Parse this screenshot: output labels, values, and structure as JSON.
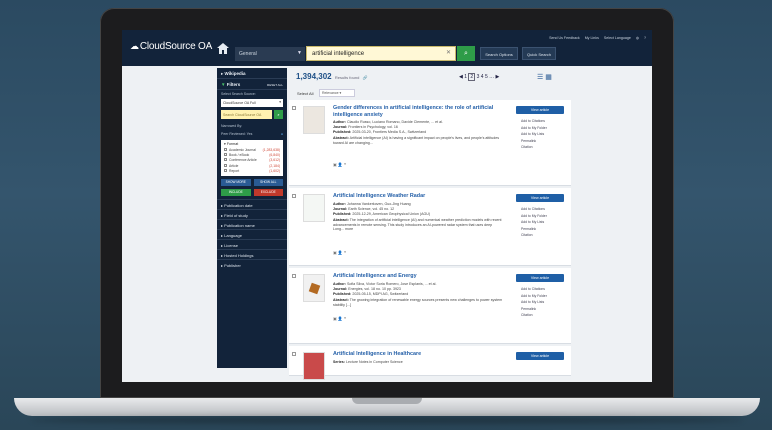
{
  "header": {
    "logo": "CloudSource OA",
    "search_type": "General",
    "search_query": "artificial intelligence",
    "btn_search_options": "Search Options",
    "btn_quick_search": "Quick Search",
    "top_links": [
      "Send Us Feedback",
      "My Links",
      "Select Language"
    ]
  },
  "sidebar": {
    "wikipedia_label": "Wikipedia",
    "filters_label": "Filters",
    "reset_label": "RESET ALL",
    "select_source_label": "Select Search Source:",
    "source_value": "CloudSource OA Full",
    "search_within_placeholder": "Search CloudSource OA",
    "narrowed_by": "Narrowed By:",
    "narrowed_value": "Peer Reviewed: Yes",
    "source_type_label": "Format",
    "source_types": [
      {
        "label": "Academic Journal",
        "count": "(1,283,638)"
      },
      {
        "label": "Book / eBook",
        "count": "(6,840)"
      },
      {
        "label": "Conference Article",
        "count": "(3,612)"
      },
      {
        "label": "Article",
        "count": "(2,184)"
      },
      {
        "label": "Report",
        "count": "(1,602)"
      }
    ],
    "btn_show_more": "SHOW MORE",
    "btn_show_all": "SHOW ALL",
    "btn_include": "INCLUDE",
    "btn_exclude": "EXCLUDE",
    "categories": [
      "Publication date",
      "Field of study",
      "Publication name",
      "Language",
      "License",
      "Hosted Holdings",
      "Publisher"
    ]
  },
  "results": {
    "count": "1,394,302",
    "count_suffix": "Results found",
    "select_all": "Select All",
    "sort": "Relevance",
    "pages": [
      "1",
      "2",
      "3",
      "4",
      "5"
    ]
  },
  "cards": [
    {
      "title": "Gender differences in artificial intelligence: the role of artificial intelligence anxiety",
      "author": "Claudio Russo, Luciano Romano, Davide Clemente, ... et al.",
      "journal": "Frontiers in Psychology, vol. 16",
      "published": "2025-03-20, Frontiers Media S.A., Switzerland",
      "abstract": "Artificial intelligence (AI) is having a significant impact on people's lives, and people's attitudes toward AI are changing...",
      "view_label": "View article",
      "actions": [
        "Add to Citations",
        "Add to My Folder",
        "Add to My Lists",
        "Permalink",
        "Citation"
      ]
    },
    {
      "title": "Artificial Intelligence Weather Radar",
      "author": "Johanna Vankerkoven, Guo-Jing Huang",
      "journal": "Earth Science, vol. 45 no. 12",
      "published": "2025-12-29, American Geophysical Union (AGU)",
      "abstract": "The integration of artificial intelligence (AI) and numerical weather prediction models with recent advancements in remote sensing. This study introduces an AI-powered radar system that uses deep Long... more",
      "view_label": "View article",
      "actions": [
        "Add to Citations",
        "Add to My Folder",
        "Add to My Lists",
        "Permalink",
        "Citation"
      ]
    },
    {
      "title": "Artificial Intelligence and Energy",
      "author": "Sofia Silva, Víctor Soria Romero, Jose Esplanis, ... et al.",
      "journal": "Energies, vol. 18 no. 10 pp. 3923",
      "published": "2025-05-15, MDPI AG, Switzerland",
      "abstract": "The growing integration of renewable energy sources presents new challenges to power system stability [...]",
      "view_label": "View article",
      "actions": [
        "Add to Citations",
        "Add to My Folder",
        "Add to My Lists",
        "Permalink",
        "Citation"
      ]
    },
    {
      "title": "Artificial Intelligence in Healthcare",
      "author": "Lecture Notes in Computer Science",
      "journal": "",
      "published": "",
      "abstract": "",
      "view_label": "View article",
      "actions": []
    }
  ],
  "colors": {
    "navy": "#12233a",
    "accent_blue": "#1f5fa6",
    "green": "#2e9c48",
    "red": "#c0392b"
  }
}
